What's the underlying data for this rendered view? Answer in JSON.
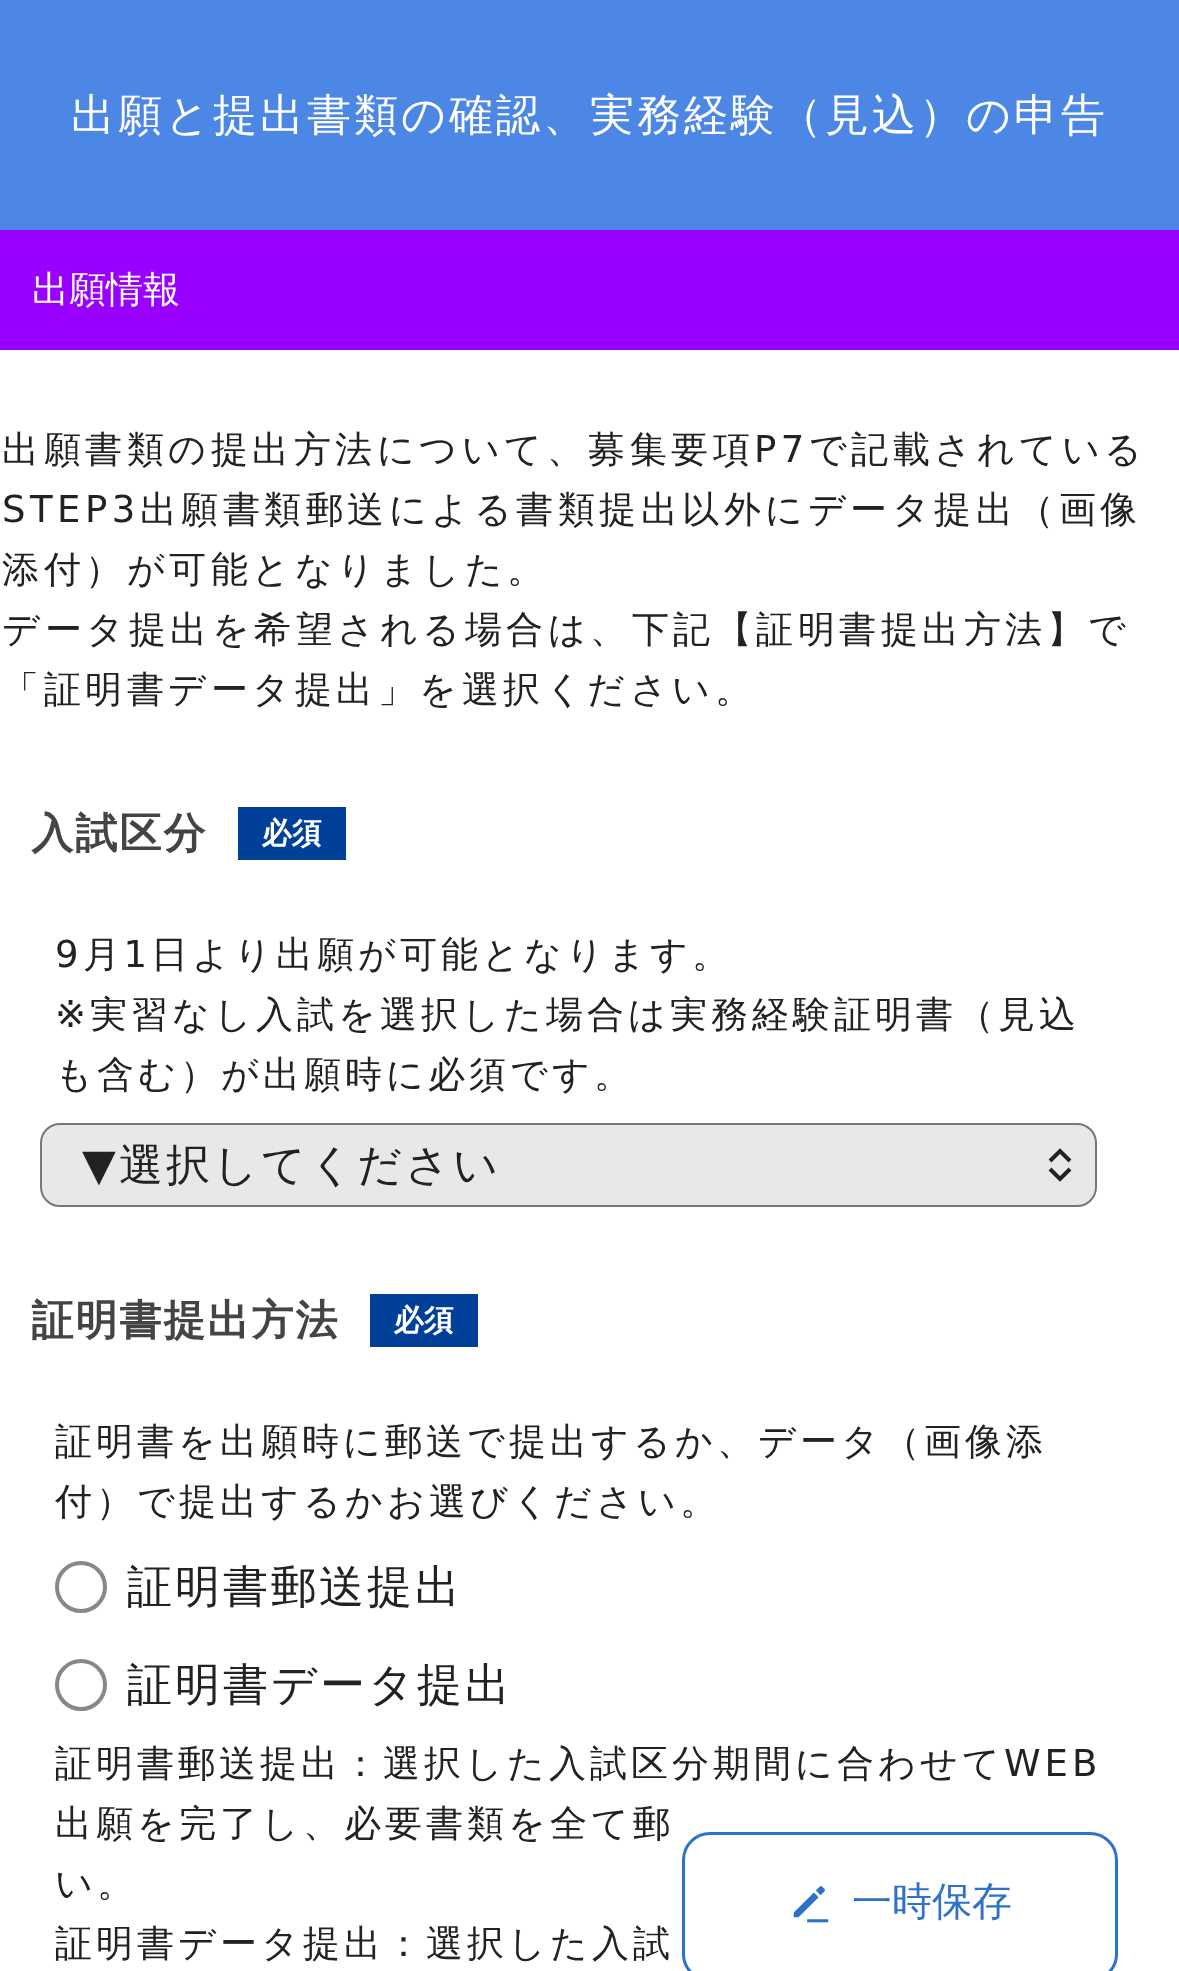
{
  "header": {
    "title": "出願と提出書類の確認、実務経験（見込）の申告"
  },
  "section_bar": {
    "label": "出願情報"
  },
  "intro": [
    "出願書類の提出方法について、募集要項P7で記載されているSTEP3出願書類郵送による書類提出以外にデータ提出（画像添付）が可能となりました。",
    "データ提出を希望される場合は、下記【証明書提出方法】で「証明書データ提出」を選択ください。"
  ],
  "fields": [
    {
      "kind": "select",
      "label": "入試区分",
      "badge": "必須",
      "notes": [
        "9月1日より出願が可能となります。",
        "※実習なし入試を選択した場合は実務経験証明書（見込も含む）が出願時に必須です。"
      ],
      "value": "▼選択してください"
    },
    {
      "kind": "radio",
      "label": "証明書提出方法",
      "badge": "必須",
      "notes": [
        "証明書を出願時に郵送で提出するか、データ（画像添付）で提出するかお選びください。"
      ],
      "options": [
        {
          "label": "証明書郵送提出",
          "selected": false
        },
        {
          "label": "証明書データ提出",
          "selected": false
        }
      ],
      "descriptions": [
        "証明書郵送提出：選択した入試区分期間に合わせてWEB",
        "出願を完了し、必要書類を全て郵",
        "い。",
        "証明書データ提出：選択した入試"
      ]
    }
  ],
  "save_button": {
    "label": "一時保存"
  }
}
